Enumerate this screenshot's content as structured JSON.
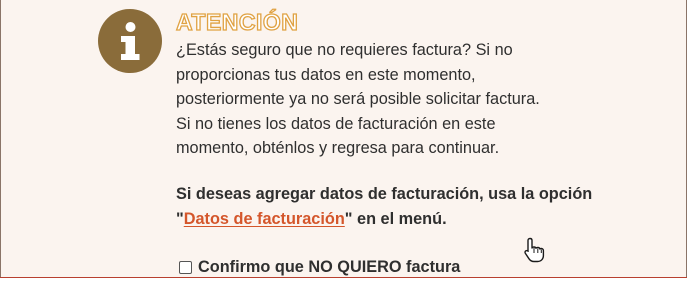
{
  "alert": {
    "icon": "info-icon",
    "title": "ATENCIÓN",
    "message_lines": [
      "¿Estás seguro que no requieres factura? Si no",
      "proporcionas tus datos en este momento,",
      "posteriormente ya no será posible solicitar factura.",
      "Si no tienes los datos de facturación en este",
      "momento, obténlos y regresa para continuar."
    ],
    "instruction_prefix": "Si deseas agregar datos de facturación, usa la opción \"",
    "instruction_link": "Datos de facturación",
    "instruction_suffix": "\" en el menú.",
    "confirm_checkbox_label": "Confirmo que NO QUIERO factura",
    "confirm_checked": false
  },
  "colors": {
    "panel_background": "#fbf4ef",
    "icon_circle": "#8a6c3a",
    "title_outline": "#e0a243",
    "link": "#d4562b",
    "bottom_border": "#b8402f"
  },
  "cursor": "hand-pointer-icon"
}
